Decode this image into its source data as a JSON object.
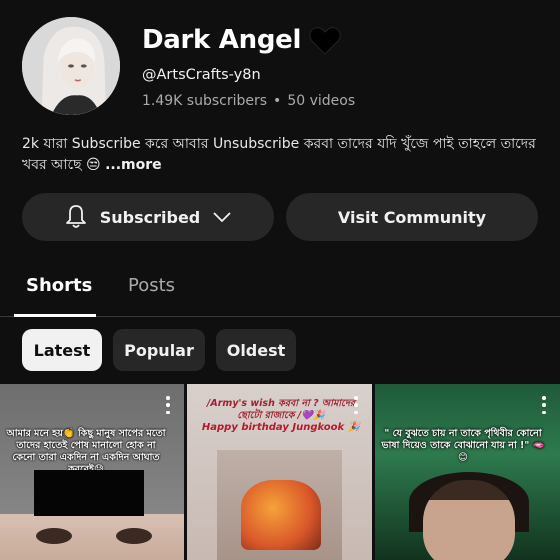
{
  "channel": {
    "name": "Dark Angel",
    "name_emoji": "black-heart-icon",
    "handle": "@ArtsCrafts-y8n",
    "subscribers": "1.49K subscribers",
    "separator": "•",
    "videos": "50 videos",
    "description": "2k  যারা Subscribe করে আবার Unsubscribe করবা তাদের যদি খুঁজে পাই তাহলে তাদের খবর আছে 😒",
    "more_label": "...more"
  },
  "actions": {
    "subscribed_label": "Subscribed",
    "visit_label": "Visit Community"
  },
  "tabs": [
    {
      "label": "Shorts",
      "active": true
    },
    {
      "label": "Posts",
      "active": false
    }
  ],
  "filters": [
    {
      "label": "Latest",
      "selected": true
    },
    {
      "label": "Popular",
      "selected": false
    },
    {
      "label": "Oldest",
      "selected": false
    }
  ],
  "shorts": [
    {
      "caption": "আমার মনে হয়👏 কিছু মানুষ সাপের মতো তাদের হাতেই পোষ মানালো হোক না কেনো তারা একদিন না একদিন আঘাত করবেই😓"
    },
    {
      "caption": "/Army's wish করবা না ? আমাদের ছোটো রাজাকে /💜🎉",
      "caption2": "Happy birthday Jungkook 🎉"
    },
    {
      "caption": "\" যে বুঝতে চায় না তাকে পৃথিবীর কোনো ভাষা দিয়েও তাকে বোঝানো যায় না !\" 🫦😊"
    }
  ],
  "colors": {
    "background": "#0f0f0f",
    "button_bg": "#272727",
    "chip_selected_bg": "#f1f1f1",
    "secondary_text": "#aaaaaa"
  }
}
